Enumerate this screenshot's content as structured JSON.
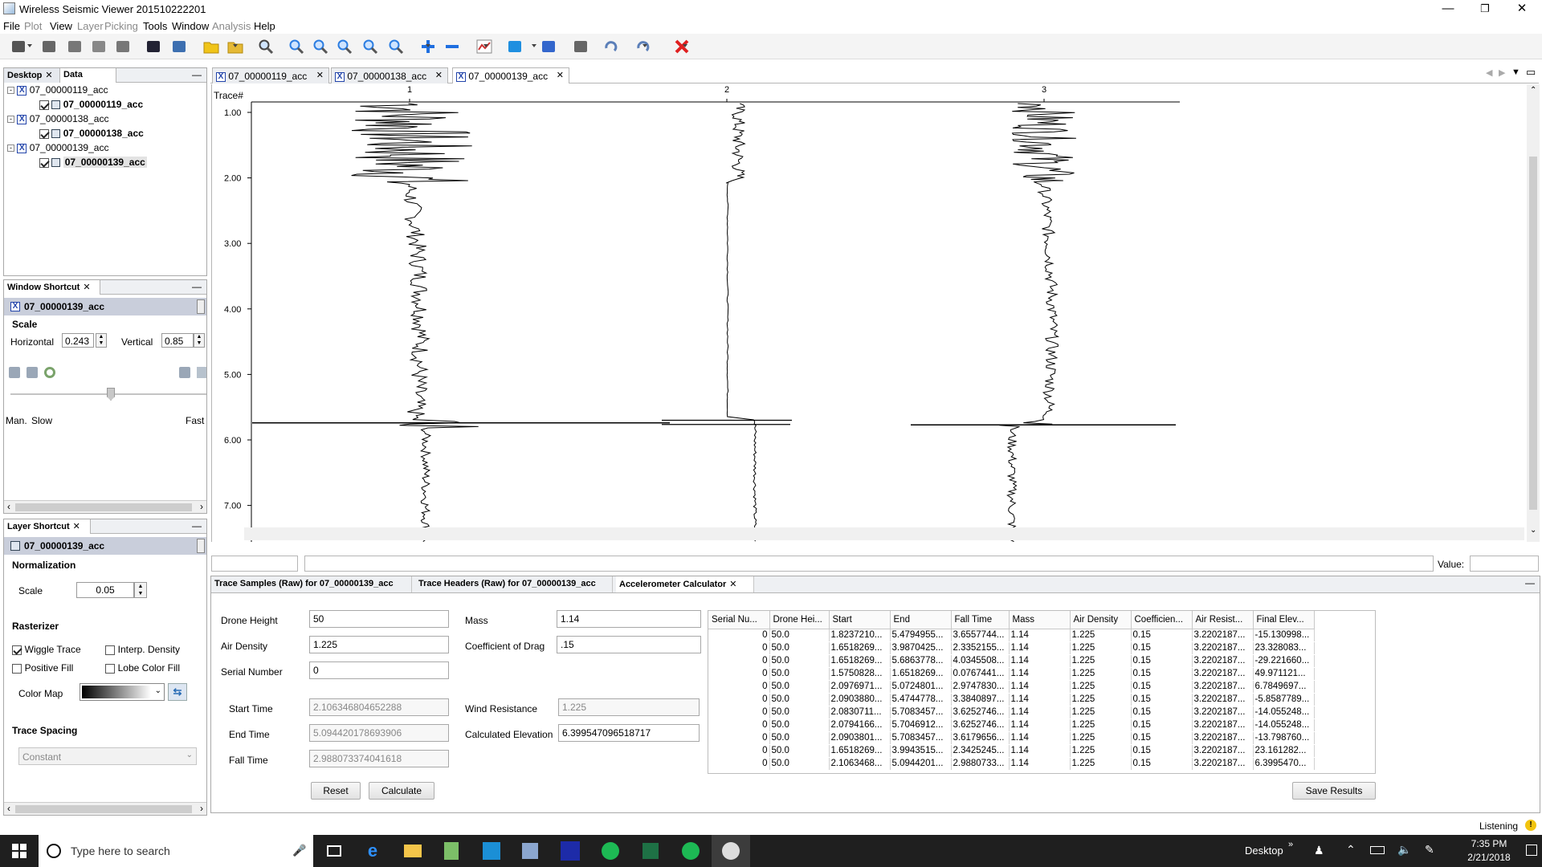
{
  "window": {
    "title": "Wireless Seismic Viewer 201510222201"
  },
  "menu": [
    {
      "label": "File",
      "enabled": true
    },
    {
      "label": "Plot",
      "enabled": false
    },
    {
      "label": "View",
      "enabled": true
    },
    {
      "label": "Layer",
      "enabled": false
    },
    {
      "label": "Picking",
      "enabled": false
    },
    {
      "label": "Tools",
      "enabled": true
    },
    {
      "label": "Window",
      "enabled": true
    },
    {
      "label": "Analysis",
      "enabled": false
    },
    {
      "label": "Help",
      "enabled": true
    }
  ],
  "toolbar_icons": [
    "pointer-icon",
    "layers-icon",
    "lock-icon",
    "save-icon",
    "save-all-icon",
    "terminal-icon",
    "python-icon",
    "open-folder-icon",
    "settings-folder-icon",
    "zoom-fit-icon",
    "zoom-in-icon",
    "zoom-out-icon",
    "zoom-icon",
    "zoom-reset-icon",
    "zoom-window-icon",
    "add-icon",
    "remove-icon",
    "chart-icon",
    "colormap-icon",
    "grid-icon",
    "camera-icon",
    "undo-icon",
    "redo-icon",
    "close-red-icon"
  ],
  "desktop_panel": {
    "tabs": [
      "Desktop",
      "Data"
    ],
    "tree": [
      {
        "name": "07_00000119_acc",
        "child": "07_00000119_acc"
      },
      {
        "name": "07_00000138_acc",
        "child": "07_00000138_acc"
      },
      {
        "name": "07_00000139_acc",
        "child": "07_00000139_acc"
      }
    ]
  },
  "window_shortcut": {
    "title": "Window Shortcut",
    "selected": "07_00000139_acc",
    "scale_label": "Scale",
    "horizontal_label": "Horizontal",
    "horizontal_value": "0.243",
    "vertical_label": "Vertical",
    "vertical_value": "0.85",
    "speed_man": "Man.",
    "speed_slow": "Slow",
    "speed_fast": "Fast"
  },
  "layer_shortcut": {
    "title": "Layer Shortcut",
    "selected": "07_00000139_acc",
    "normalization": "Normalization",
    "scale_label": "Scale",
    "scale_value": "0.05",
    "rasterizer": "Rasterizer",
    "wiggle": "Wiggle Trace",
    "interp": "Interp. Density",
    "posfill": "Positive Fill",
    "lobefill": "Lobe Color Fill",
    "colormap": "Color Map",
    "trace_spacing": "Trace Spacing",
    "spacing_value": "Constant"
  },
  "doc_tabs": [
    "07_00000119_acc",
    "07_00000138_acc",
    "07_00000139_acc"
  ],
  "plot": {
    "trace_label": "Trace#",
    "traces": [
      "1",
      "2",
      "3"
    ],
    "y_ticks": [
      "1.00",
      "2.00",
      "3.00",
      "4.00",
      "5.00",
      "6.00",
      "7.00"
    ],
    "value_label": "Value:"
  },
  "bottom_tabs": [
    "Trace Samples (Raw) for 07_00000139_acc",
    "Trace Headers (Raw) for 07_00000139_acc",
    "Accelerometer Calculator"
  ],
  "calc": {
    "drone_height_label": "Drone Height",
    "drone_height": "50",
    "air_density_label": "Air Density",
    "air_density": "1.225",
    "serial_label": "Serial Number",
    "serial": "0",
    "mass_label": "Mass",
    "mass": "1.14",
    "drag_label": "Coefficient of Drag",
    "drag": ".15",
    "start_label": "Start Time",
    "start": "2.106346804652288",
    "end_label": "End Time",
    "end": "5.094420178693906",
    "fall_label": "Fall Time",
    "fall": "2.988073374041618",
    "wind_label": "Wind Resistance",
    "wind": "1.225",
    "elev_label": "Calculated Elevation",
    "elev": "6.399547096518717",
    "reset": "Reset",
    "calculate": "Calculate",
    "save": "Save Results"
  },
  "results": {
    "headers": [
      "Serial Nu...",
      "Drone Hei...",
      "Start",
      "End",
      "Fall Time",
      "Mass",
      "Air Density",
      "Coefficien...",
      "Air Resist...",
      "Final Elev..."
    ],
    "rows": [
      [
        "0",
        "50.0",
        "1.8237210...",
        "5.4794955...",
        "3.6557744...",
        "1.14",
        "1.225",
        "0.15",
        "3.2202187...",
        "-15.130998..."
      ],
      [
        "0",
        "50.0",
        "1.6518269...",
        "3.9870425...",
        "2.3352155...",
        "1.14",
        "1.225",
        "0.15",
        "3.2202187...",
        "23.328083..."
      ],
      [
        "0",
        "50.0",
        "1.6518269...",
        "5.6863778...",
        "4.0345508...",
        "1.14",
        "1.225",
        "0.15",
        "3.2202187...",
        "-29.221660..."
      ],
      [
        "0",
        "50.0",
        "1.5750828...",
        "1.6518269...",
        "0.0767441...",
        "1.14",
        "1.225",
        "0.15",
        "3.2202187...",
        "49.971121..."
      ],
      [
        "0",
        "50.0",
        "2.0976971...",
        "5.0724801...",
        "2.9747830...",
        "1.14",
        "1.225",
        "0.15",
        "3.2202187...",
        "6.7849697..."
      ],
      [
        "0",
        "50.0",
        "2.0903880...",
        "5.4744778...",
        "3.3840897...",
        "1.14",
        "1.225",
        "0.15",
        "3.2202187...",
        "-5.8587789..."
      ],
      [
        "0",
        "50.0",
        "2.0830711...",
        "5.7083457...",
        "3.6252746...",
        "1.14",
        "1.225",
        "0.15",
        "3.2202187...",
        "-14.055248..."
      ],
      [
        "0",
        "50.0",
        "2.0794166...",
        "5.7046912...",
        "3.6252746...",
        "1.14",
        "1.225",
        "0.15",
        "3.2202187...",
        "-14.055248..."
      ],
      [
        "0",
        "50.0",
        "2.0903801...",
        "5.7083457...",
        "3.6179656...",
        "1.14",
        "1.225",
        "0.15",
        "3.2202187...",
        "-13.798760..."
      ],
      [
        "0",
        "50.0",
        "1.6518269...",
        "3.9943515...",
        "2.3425245...",
        "1.14",
        "1.225",
        "0.15",
        "3.2202187...",
        "23.161282..."
      ],
      [
        "0",
        "50.0",
        "2.1063468...",
        "5.0944201...",
        "2.9880733...",
        "1.14",
        "1.225",
        "0.15",
        "3.2202187...",
        "6.3995470..."
      ]
    ]
  },
  "status": {
    "listening": "Listening"
  },
  "taskbar": {
    "search_placeholder": "Type here to search",
    "desktop_label": "Desktop",
    "time": "7:35 PM",
    "date": "2/21/2018"
  }
}
